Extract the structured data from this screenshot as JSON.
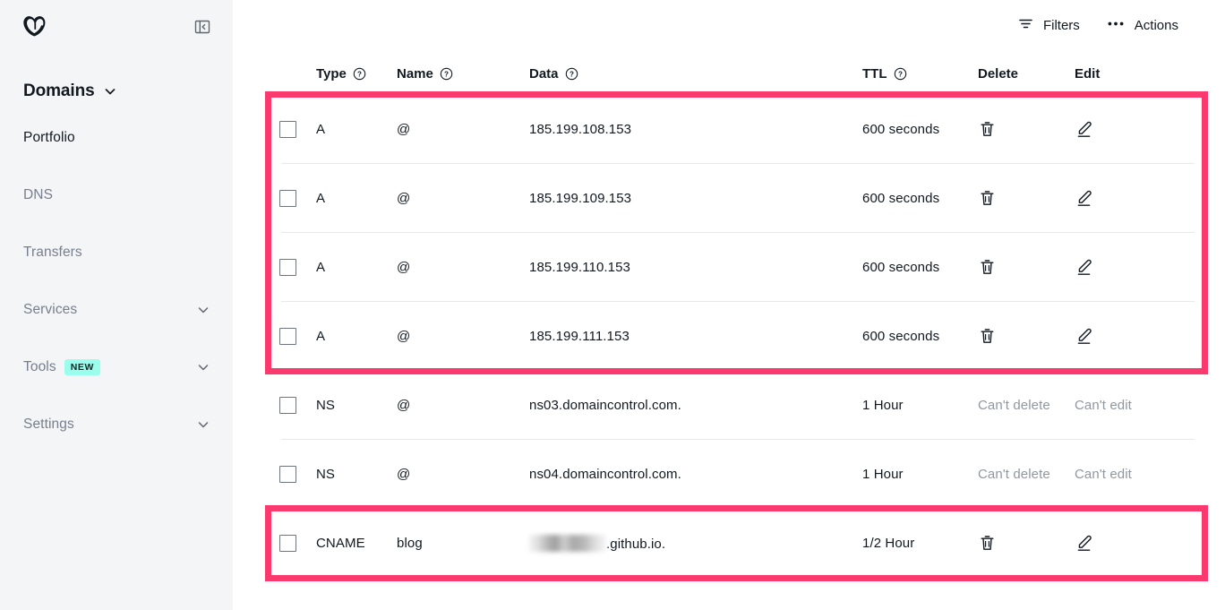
{
  "sidebar": {
    "logo_name": "godaddy-logo",
    "collapse_icon": "collapse-sidebar-icon",
    "section_title": "Domains",
    "items": [
      {
        "label": "Portfolio",
        "active": true,
        "has_chevron": false,
        "badge": null
      },
      {
        "label": "DNS",
        "active": false,
        "has_chevron": false,
        "badge": null
      },
      {
        "label": "Transfers",
        "active": false,
        "has_chevron": false,
        "badge": null
      },
      {
        "label": "Services",
        "active": false,
        "has_chevron": true,
        "badge": null
      },
      {
        "label": "Tools",
        "active": false,
        "has_chevron": true,
        "badge": "NEW"
      },
      {
        "label": "Settings",
        "active": false,
        "has_chevron": true,
        "badge": null
      }
    ]
  },
  "toolbar": {
    "filters_label": "Filters",
    "filters_icon": "filter-icon",
    "actions_label": "Actions",
    "actions_icon": "ellipsis-icon"
  },
  "table": {
    "headers": {
      "type": "Type",
      "name": "Name",
      "data": "Data",
      "ttl": "TTL",
      "delete": "Delete",
      "edit": "Edit",
      "help_icon": "help-circle-icon"
    },
    "rows": [
      {
        "type": "A",
        "name": "@",
        "data": "185.199.108.153",
        "data_redacted": false,
        "ttl": "600 seconds",
        "delete": "trash-icon",
        "edit": "pencil-icon",
        "delete_disabled_text": null,
        "edit_disabled_text": null
      },
      {
        "type": "A",
        "name": "@",
        "data": "185.199.109.153",
        "data_redacted": false,
        "ttl": "600 seconds",
        "delete": "trash-icon",
        "edit": "pencil-icon",
        "delete_disabled_text": null,
        "edit_disabled_text": null
      },
      {
        "type": "A",
        "name": "@",
        "data": "185.199.110.153",
        "data_redacted": false,
        "ttl": "600 seconds",
        "delete": "trash-icon",
        "edit": "pencil-icon",
        "delete_disabled_text": null,
        "edit_disabled_text": null
      },
      {
        "type": "A",
        "name": "@",
        "data": "185.199.111.153",
        "data_redacted": false,
        "ttl": "600 seconds",
        "delete": "trash-icon",
        "edit": "pencil-icon",
        "delete_disabled_text": null,
        "edit_disabled_text": null
      },
      {
        "type": "NS",
        "name": "@",
        "data": "ns03.domaincontrol.com.",
        "data_redacted": false,
        "ttl": "1 Hour",
        "delete": null,
        "edit": null,
        "delete_disabled_text": "Can't delete",
        "edit_disabled_text": "Can't edit"
      },
      {
        "type": "NS",
        "name": "@",
        "data": "ns04.domaincontrol.com.",
        "data_redacted": false,
        "ttl": "1 Hour",
        "delete": null,
        "edit": null,
        "delete_disabled_text": "Can't delete",
        "edit_disabled_text": "Can't edit"
      },
      {
        "type": "CNAME",
        "name": "blog",
        "data": ".github.io.",
        "data_redacted": true,
        "ttl": "1/2 Hour",
        "delete": "trash-icon",
        "edit": "pencil-icon",
        "delete_disabled_text": null,
        "edit_disabled_text": null
      }
    ]
  },
  "highlights": {
    "accent_color": "#fa3a6e",
    "boxes": [
      {
        "name": "a-records-highlight",
        "rows": [
          0,
          1,
          2,
          3
        ]
      },
      {
        "name": "cname-record-highlight",
        "rows": [
          6
        ]
      }
    ]
  },
  "colors": {
    "sidebar_bg": "#f4f5f7",
    "text_primary": "#111820",
    "text_muted": "#767f8c",
    "badge_bg": "#9bfdeb",
    "accent_pink": "#fa3a6e",
    "divider": "#e8e9ea"
  }
}
